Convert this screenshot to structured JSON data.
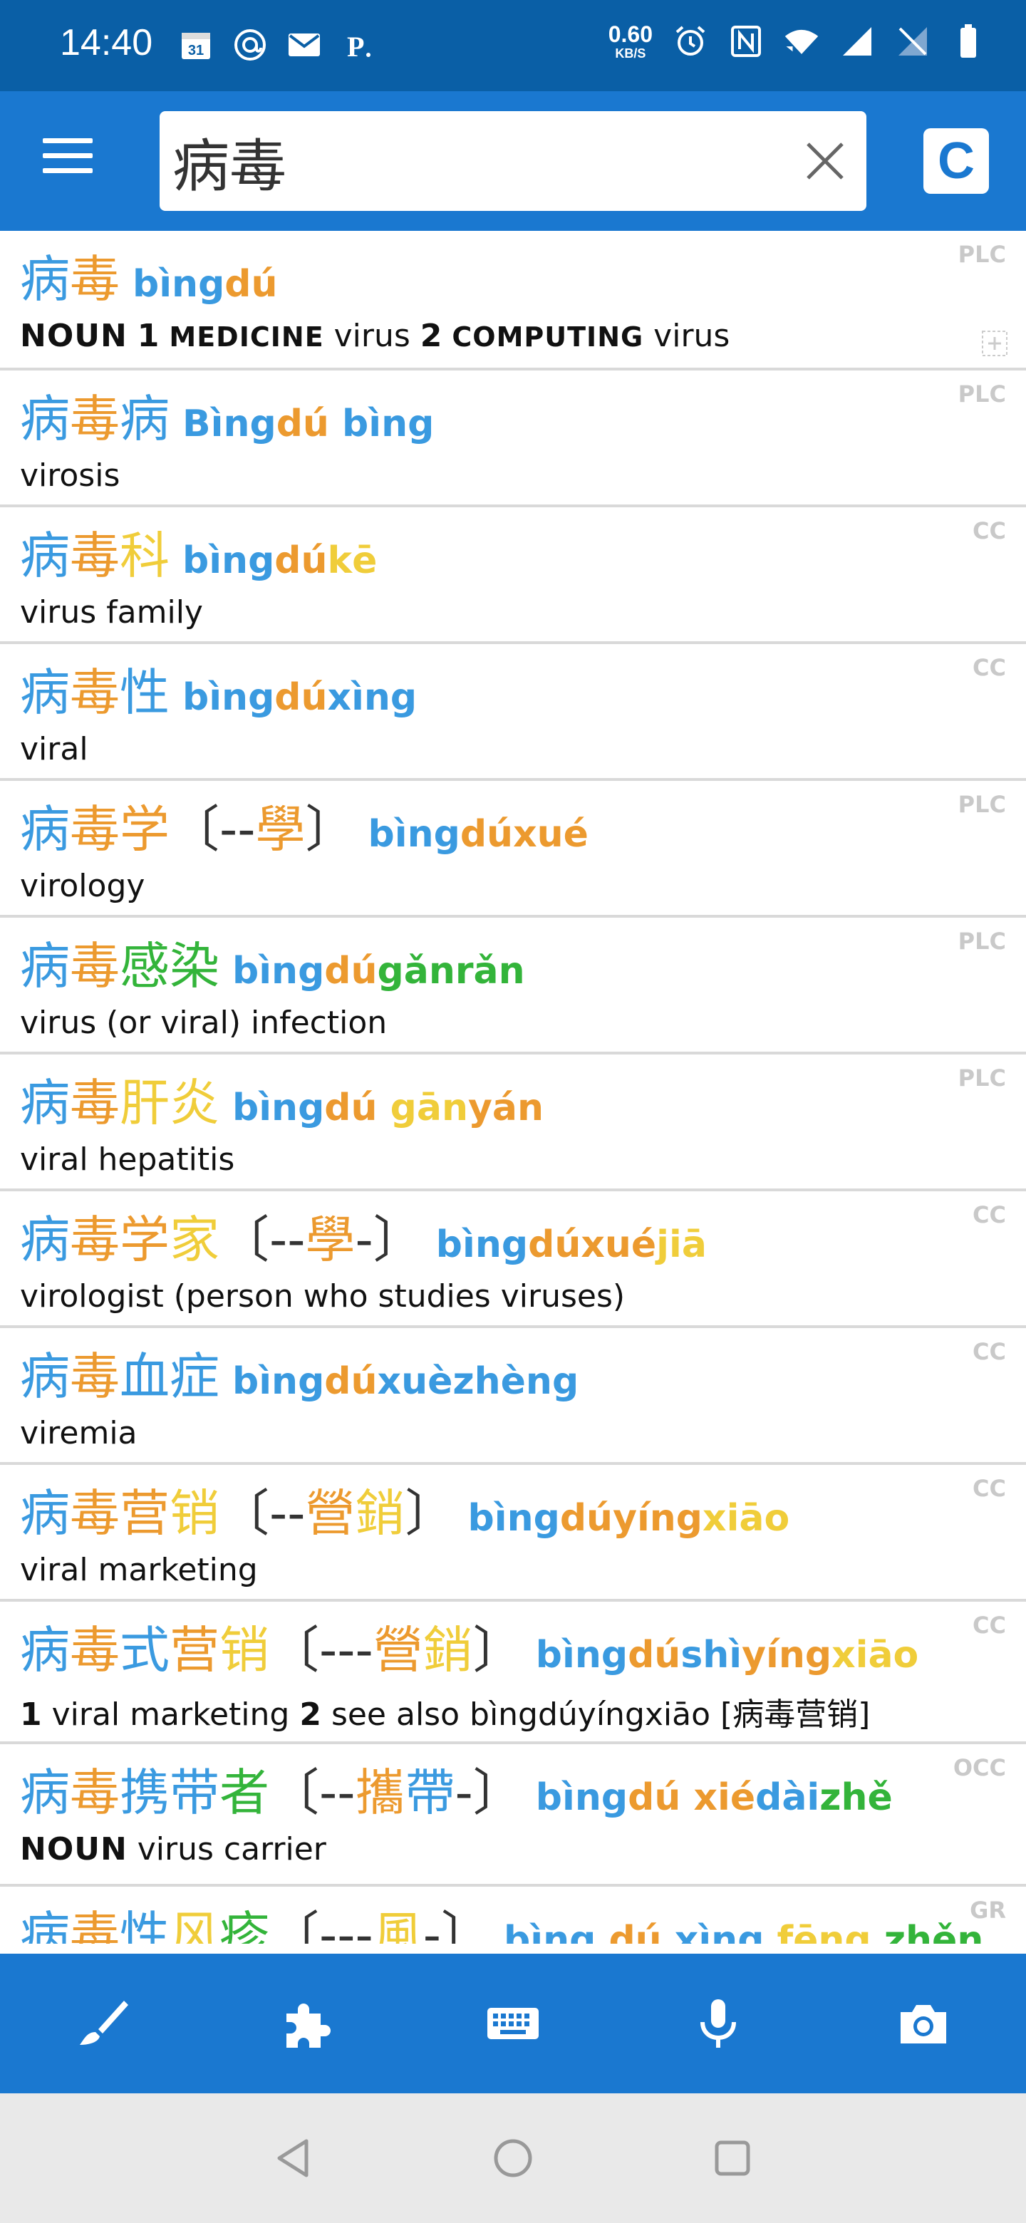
{
  "status_bar": {
    "time": "14:40",
    "net_speed_value": "0.60",
    "net_speed_unit": "KB/S",
    "icons_left": [
      "calendar-icon",
      "at-icon",
      "mail-icon",
      "parking-icon"
    ],
    "icons_right": [
      "alarm-icon",
      "nfc-icon",
      "wifi-icon",
      "signal-icon",
      "no-sim-icon",
      "battery-icon"
    ]
  },
  "app_bar": {
    "search_value": "病毒",
    "mode_button": "C"
  },
  "colors": {
    "primary": "#1a78d0",
    "status_bar": "#0a5fa6",
    "tone_blue": "#3a9ae0",
    "tone_orange": "#ec9a2f",
    "tone_yellow": "#f0cd3a",
    "tone_green": "#33b43a"
  },
  "results": [
    {
      "hz": [
        [
          "病",
          "bl"
        ],
        [
          "毒",
          "or"
        ]
      ],
      "trad": "",
      "py": [
        [
          "bìng",
          "bl"
        ],
        [
          "dú",
          "or"
        ]
      ],
      "src": "PLC",
      "def_parts": [
        [
          "NOUN",
          "pos"
        ],
        [
          " ",
          ""
        ],
        [
          "1",
          "num"
        ],
        [
          " ",
          ""
        ],
        [
          "MEDICINE",
          "sc"
        ],
        [
          " virus ",
          ""
        ],
        [
          "2",
          "num"
        ],
        [
          " ",
          ""
        ],
        [
          "COMPUTING",
          "sc"
        ],
        [
          " virus",
          ""
        ]
      ]
    },
    {
      "hz": [
        [
          "病",
          "bl"
        ],
        [
          "毒",
          "or"
        ],
        [
          "病",
          "bl"
        ]
      ],
      "trad": "",
      "py": [
        [
          "Bìng",
          "bl"
        ],
        [
          "dú",
          "or"
        ],
        [
          " bìng",
          "bl"
        ]
      ],
      "src": "PLC",
      "def_parts": [
        [
          "virosis",
          ""
        ]
      ]
    },
    {
      "hz": [
        [
          "病",
          "bl"
        ],
        [
          "毒",
          "or"
        ],
        [
          "科",
          "ye"
        ]
      ],
      "trad": "",
      "py": [
        [
          "bìng",
          "bl"
        ],
        [
          "dú",
          "or"
        ],
        [
          "kē",
          "ye"
        ]
      ],
      "src": "CC",
      "def_parts": [
        [
          "virus family",
          ""
        ]
      ]
    },
    {
      "hz": [
        [
          "病",
          "bl"
        ],
        [
          "毒",
          "or"
        ],
        [
          "性",
          "bl"
        ]
      ],
      "trad": "",
      "py": [
        [
          "bìng",
          "bl"
        ],
        [
          "dú",
          "or"
        ],
        [
          "xìng",
          "bl"
        ]
      ],
      "src": "CC",
      "def_parts": [
        [
          "viral",
          ""
        ]
      ]
    },
    {
      "hz": [
        [
          "病",
          "bl"
        ],
        [
          "毒",
          "or"
        ],
        [
          "学",
          "or"
        ]
      ],
      "trad": [
        [
          "〔--",
          ""
        ],
        [
          "學",
          "or"
        ],
        [
          "〕",
          ""
        ]
      ],
      "py": [
        [
          "bìng",
          "bl"
        ],
        [
          "dúxué",
          "or"
        ]
      ],
      "src": "PLC",
      "def_parts": [
        [
          "virology",
          ""
        ]
      ]
    },
    {
      "hz": [
        [
          "病",
          "bl"
        ],
        [
          "毒",
          "or"
        ],
        [
          "感",
          "gr"
        ],
        [
          "染",
          "gr"
        ]
      ],
      "trad": "",
      "py": [
        [
          "bìng",
          "bl"
        ],
        [
          "dú",
          "or"
        ],
        [
          "gǎnrǎn",
          "gr"
        ]
      ],
      "src": "PLC",
      "def_parts": [
        [
          "virus (or viral) infection",
          ""
        ]
      ]
    },
    {
      "hz": [
        [
          "病",
          "bl"
        ],
        [
          "毒",
          "or"
        ],
        [
          "肝",
          "ye"
        ],
        [
          "炎",
          "ye"
        ]
      ],
      "trad": "",
      "py": [
        [
          "bìng",
          "bl"
        ],
        [
          "dú",
          "or"
        ],
        [
          " gān",
          "ye"
        ],
        [
          "yán",
          "or"
        ]
      ],
      "src": "PLC",
      "def_parts": [
        [
          "viral hepatitis",
          ""
        ]
      ]
    },
    {
      "hz": [
        [
          "病",
          "bl"
        ],
        [
          "毒",
          "or"
        ],
        [
          "学",
          "or"
        ],
        [
          "家",
          "ye"
        ]
      ],
      "trad": [
        [
          "〔--",
          ""
        ],
        [
          "學",
          "or"
        ],
        [
          "-〕",
          ""
        ]
      ],
      "py": [
        [
          "bìng",
          "bl"
        ],
        [
          "dúxué",
          "or"
        ],
        [
          "jiā",
          "ye"
        ]
      ],
      "src": "CC",
      "def_parts": [
        [
          "virologist (person who studies viruses)",
          ""
        ]
      ]
    },
    {
      "hz": [
        [
          "病",
          "bl"
        ],
        [
          "毒",
          "or"
        ],
        [
          "血",
          "bl"
        ],
        [
          "症",
          "bl"
        ]
      ],
      "trad": "",
      "py": [
        [
          "bìng",
          "bl"
        ],
        [
          "dú",
          "or"
        ],
        [
          "xuèzhèng",
          "bl"
        ]
      ],
      "src": "CC",
      "def_parts": [
        [
          "viremia",
          ""
        ]
      ]
    },
    {
      "hz": [
        [
          "病",
          "bl"
        ],
        [
          "毒",
          "or"
        ],
        [
          "营",
          "or"
        ],
        [
          "销",
          "ye"
        ]
      ],
      "trad": [
        [
          "〔--",
          ""
        ],
        [
          "營",
          "or"
        ],
        [
          "銷",
          "ye"
        ],
        [
          "〕",
          ""
        ]
      ],
      "py": [
        [
          "bìng",
          "bl"
        ],
        [
          "dúyíng",
          "or"
        ],
        [
          "xiāo",
          "ye"
        ]
      ],
      "src": "CC",
      "def_parts": [
        [
          "viral marketing",
          ""
        ]
      ]
    },
    {
      "hz": [
        [
          "病",
          "bl"
        ],
        [
          "毒",
          "or"
        ],
        [
          "式",
          "bl"
        ],
        [
          "营",
          "or"
        ],
        [
          "销",
          "ye"
        ]
      ],
      "trad": [
        [
          "〔---",
          ""
        ],
        [
          "營",
          "or"
        ],
        [
          "銷",
          "ye"
        ],
        [
          "〕",
          ""
        ]
      ],
      "py": [
        [
          "bìng",
          "bl"
        ],
        [
          "dú",
          "or"
        ],
        [
          "shì",
          "bl"
        ],
        [
          "yíng",
          "or"
        ],
        [
          "xiāo",
          "ye"
        ]
      ],
      "src": "CC",
      "def_parts": [
        [
          "1",
          "num"
        ],
        [
          " viral marketing  ",
          ""
        ],
        [
          "2",
          "num"
        ],
        [
          " see also bìngdúyíngxiāo [病毒营销]",
          ""
        ]
      ]
    },
    {
      "hz": [
        [
          "病",
          "bl"
        ],
        [
          "毒",
          "or"
        ],
        [
          "携",
          "bl"
        ],
        [
          "带",
          "bl"
        ],
        [
          "者",
          "gr"
        ]
      ],
      "trad": [
        [
          "〔--",
          ""
        ],
        [
          "攜",
          "or"
        ],
        [
          "帶",
          "bl"
        ],
        [
          "-〕",
          ""
        ]
      ],
      "py": [
        [
          "bìng",
          "bl"
        ],
        [
          "dú",
          "or"
        ],
        [
          " xié",
          "or"
        ],
        [
          "dài",
          "bl"
        ],
        [
          "zhě",
          "gr"
        ]
      ],
      "src": "OCC",
      "def_parts": [
        [
          "NOUN",
          "pos"
        ],
        [
          " virus carrier",
          ""
        ]
      ]
    },
    {
      "hz": [
        [
          "病",
          "bl"
        ],
        [
          "毒",
          "or"
        ],
        [
          "性",
          "bl"
        ],
        [
          "风",
          "ye"
        ],
        [
          "疹",
          "gr"
        ]
      ],
      "trad": [
        [
          "〔---",
          ""
        ],
        [
          "風",
          "ye"
        ],
        [
          "-〕",
          ""
        ]
      ],
      "py": [
        [
          "bìng",
          "bl"
        ],
        [
          " dú",
          "or"
        ],
        [
          " xìng",
          "bl"
        ],
        [
          " fēng",
          "ye"
        ],
        [
          " zhěn",
          "gr"
        ]
      ],
      "src": "GR",
      "def_parts": []
    }
  ],
  "toolbar": [
    "brush-icon",
    "puzzle-icon",
    "keyboard-icon",
    "microphone-icon",
    "camera-icon"
  ],
  "navbar": [
    "back-icon",
    "home-icon",
    "recents-icon"
  ]
}
